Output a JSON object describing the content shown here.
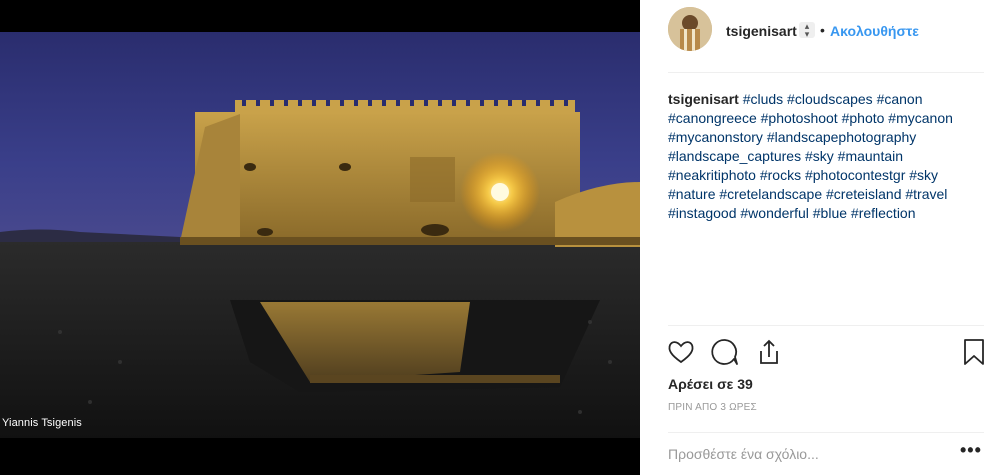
{
  "photo": {
    "watermark": "Yiannis Tsigenis"
  },
  "post": {
    "username": "tsigenisart",
    "separator": "•",
    "follow_label": "Ακολουθήστε",
    "caption": {
      "username": "tsigenisart",
      "hashtags": "#cluds #cloudscapes #canon #canongreece #photoshoot #photo #mycanon #mycanonstory #landscapephotography #landscape_captures #sky #mauntain #neakritiphoto #rocks #photocontestgr #sky #nature #cretelandscape #creteisland #travel #instagood #wonderful #blue #reflection"
    },
    "likes_text": "Αρέσει σε 39",
    "time_text": "ΠΡΙΝ ΑΠΟ 3 ΩΡΕΣ",
    "comment_placeholder": "Προσθέστε ένα σχόλιο...",
    "more_label": "•••"
  },
  "icons": [
    "heart-icon",
    "comment-icon",
    "share-icon",
    "bookmark-icon",
    "avatar-image"
  ],
  "colors": {
    "link_blue": "#3897f0",
    "hashtag": "#003569",
    "text": "#262626",
    "muted": "#999999",
    "divider": "#efefef"
  }
}
